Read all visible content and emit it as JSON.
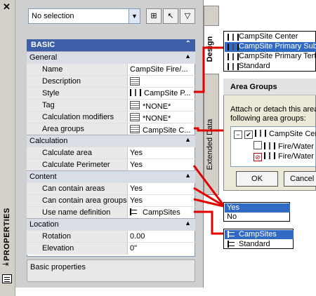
{
  "palette": {
    "title": "PROPERTIES",
    "close_glyph": "✕"
  },
  "selection": {
    "value": "No selection"
  },
  "toolbar": {
    "icons": [
      "quick-select-icon",
      "pick-objects-icon",
      "filter-icon"
    ]
  },
  "grid": {
    "header": "BASIC",
    "categories": {
      "general": "General",
      "calculation": "Calculation",
      "content": "Content",
      "location": "Location"
    },
    "rows": {
      "name": {
        "label": "Name",
        "value": "CampSite Fire/..."
      },
      "description": {
        "label": "Description",
        "value": ""
      },
      "style": {
        "label": "Style",
        "value": "CampSite P..."
      },
      "tag": {
        "label": "Tag",
        "value": "*NONE*"
      },
      "calc_mod": {
        "label": "Calculation modifiers",
        "value": "*NONE*"
      },
      "area_groups": {
        "label": "Area groups",
        "value": "CampSite C..."
      },
      "calc_area": {
        "label": "Calculate area",
        "value": "Yes"
      },
      "calc_perim": {
        "label": "Calculate Perimeter",
        "value": "Yes"
      },
      "contain_areas": {
        "label": "Can contain areas",
        "value": "Yes"
      },
      "contain_groups": {
        "label": "Can contain area groups",
        "value": "Yes"
      },
      "name_def": {
        "label": "Use name definition",
        "value": "CampSites"
      },
      "rotation": {
        "label": "Rotation",
        "value": "0.00"
      },
      "elevation": {
        "label": "Elevation",
        "value": "0\""
      }
    },
    "description_panel": "Basic properties"
  },
  "tabs": {
    "design": "Design",
    "extended": "Extended Data"
  },
  "style_popup": {
    "items": [
      "CampSite Center",
      "CampSite Primary Subdi",
      "CampSite Primary Tert",
      "Standard"
    ],
    "selected_index": 1
  },
  "area_groups_dialog": {
    "title": "Area Groups",
    "text_line1": "Attach or detach this area",
    "text_line2": "following area groups:",
    "tree": {
      "root": "CampSite Center",
      "child1": "Fire/Water",
      "child2": "Fire/Water"
    },
    "ok": "OK",
    "cancel": "Cancel"
  },
  "yes_no_popup": {
    "yes": "Yes",
    "no": "No",
    "selected": "Yes"
  },
  "name_def_popup": {
    "items": [
      "CampSites",
      "Standard"
    ],
    "selected": "CampSites"
  },
  "colors": {
    "header": "#3d5fa8",
    "selection": "#316ac5",
    "callout": "#e00000"
  }
}
